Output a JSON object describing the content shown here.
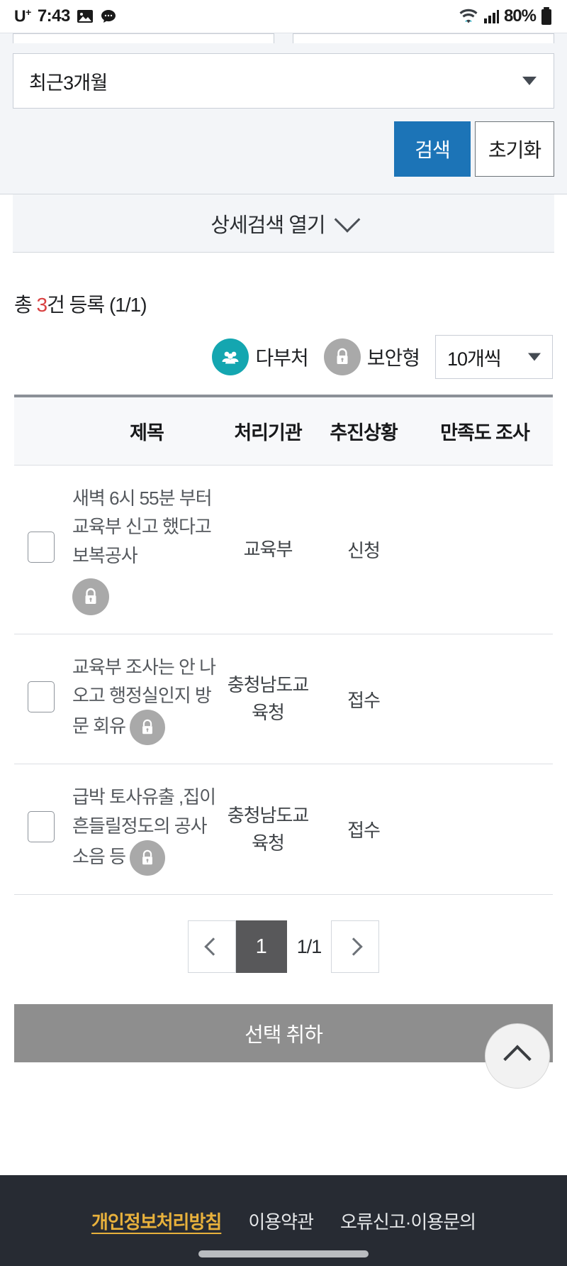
{
  "status_bar": {
    "carrier": "U",
    "carrier_sup": "+",
    "time": "7:43",
    "image_icon": "image-icon",
    "chat_icon": "chat-bubble-icon",
    "wifi_icon": "wifi-icon",
    "signal_icon": "cellular-signal-icon",
    "battery_percent": "80%",
    "battery_icon": "battery-icon"
  },
  "search": {
    "period_value": "최근3개월",
    "search_button": "검색",
    "reset_button": "초기화",
    "detail_toggle": "상세검색 열기",
    "accent_color": "#1c74b7"
  },
  "results": {
    "count_prefix": "총 ",
    "count_number": "3",
    "count_suffix": "건 등록 (1/1)",
    "count_number_color": "#d94141",
    "legend": [
      {
        "label": "다부처",
        "icon": "multi-department-people-icon",
        "color": "#14a6b0"
      },
      {
        "label": "보안형",
        "icon": "lock-icon",
        "color": "#a9a9a9"
      }
    ],
    "per_page_value": "10개씩"
  },
  "table": {
    "headers": [
      "제목",
      "처리기관",
      "추진상황",
      "만족도 조사"
    ],
    "rows": [
      {
        "title": "새벽 6시 55분 부터 교육부 신고 했다고 보복공사",
        "secure": true,
        "secure_position": "below",
        "org": "교육부",
        "status": "신청",
        "survey": ""
      },
      {
        "title": "교육부 조사는 안 나오고 행정실인지 방문 회유",
        "secure": true,
        "secure_position": "inline",
        "org": "충청남도교육청",
        "status": "접수",
        "survey": ""
      },
      {
        "title": "급박 토사유출 ,집이 흔들릴정도의 공사 소음 등",
        "secure": true,
        "secure_position": "inline",
        "org": "충청남도교육청",
        "status": "접수",
        "survey": ""
      }
    ]
  },
  "pagination": {
    "prev_icon": "chevron-left-icon",
    "current_page": "1",
    "page_info": "1/1",
    "next_icon": "chevron-right-icon"
  },
  "actions": {
    "cancel_selected": "선택 취하"
  },
  "scroll_top": {
    "icon": "chevron-up-icon"
  },
  "footer": {
    "links": [
      "개인정보처리방침",
      "이용약관",
      "오류신고·이용문의"
    ],
    "highlight_color": "#e8b13c",
    "background": "#272b33"
  }
}
